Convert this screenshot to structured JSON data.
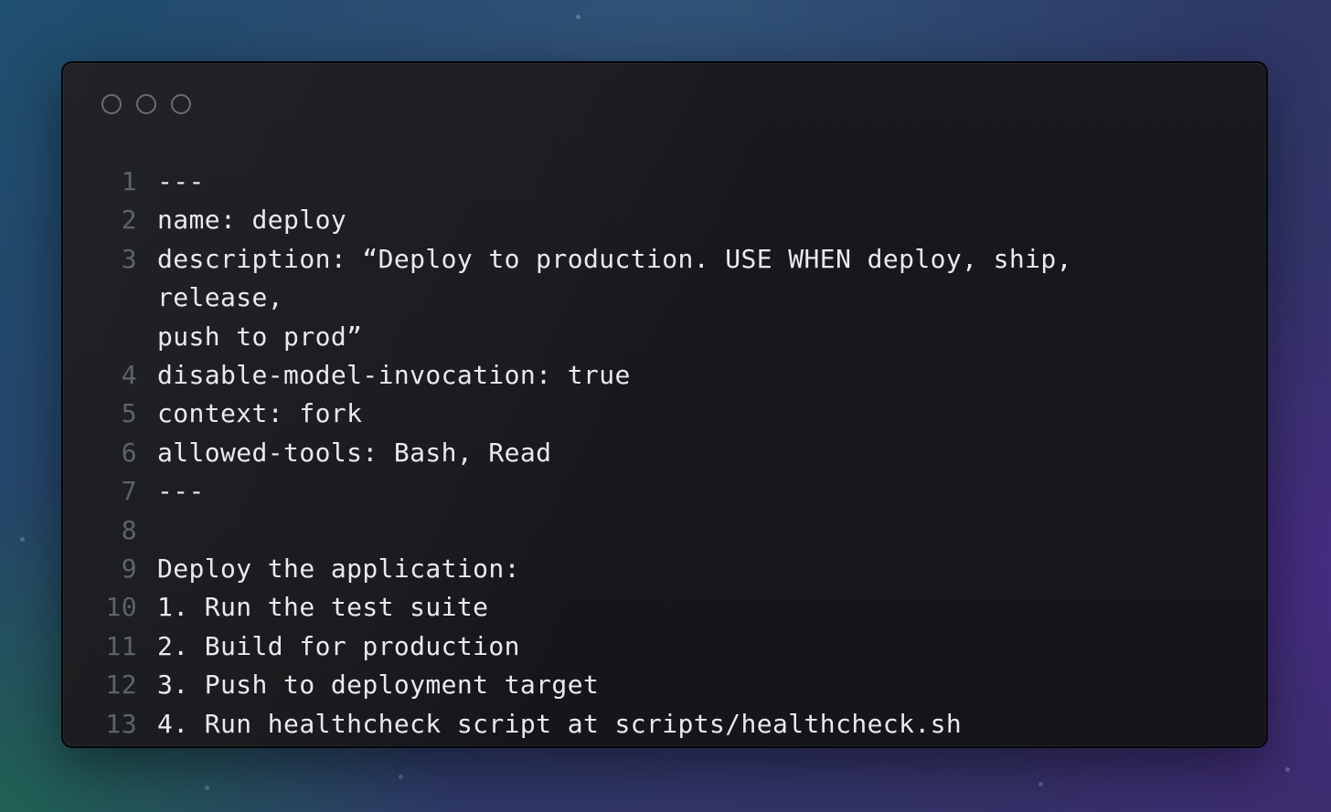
{
  "editor": {
    "lines": [
      {
        "num": "1",
        "text": "---"
      },
      {
        "num": "2",
        "text": "name: deploy"
      },
      {
        "num": "3",
        "text": "description: “Deploy to production. USE WHEN deploy, ship, release,\npush to prod”"
      },
      {
        "num": "4",
        "text": "disable-model-invocation: true"
      },
      {
        "num": "5",
        "text": "context: fork"
      },
      {
        "num": "6",
        "text": "allowed-tools: Bash, Read"
      },
      {
        "num": "7",
        "text": "---"
      },
      {
        "num": "8",
        "text": ""
      },
      {
        "num": "9",
        "text": "Deploy the application:"
      },
      {
        "num": "10",
        "text": "1. Run the test suite"
      },
      {
        "num": "11",
        "text": "2. Build for production"
      },
      {
        "num": "12",
        "text": "3. Push to deployment target"
      },
      {
        "num": "13",
        "text": "4. Run healthcheck script at scripts/healthcheck.sh"
      }
    ]
  }
}
